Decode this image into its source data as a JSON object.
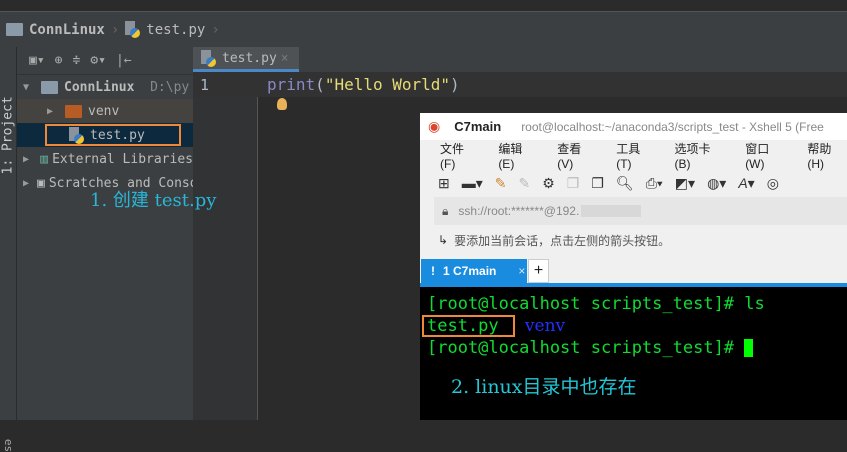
{
  "breadcrumb": {
    "project": "ConnLinux",
    "file": "test.py"
  },
  "toolwindow": {
    "label": "1: Project",
    "bottom_label": "es"
  },
  "project_tree": {
    "root": "ConnLinux",
    "root_path": "D:\\py",
    "items": [
      "venv",
      "test.py",
      "External Libraries",
      "Scratches and Consoles"
    ]
  },
  "editor": {
    "tab": "test.py",
    "line_number": "1",
    "code_fn": "print",
    "code_open": "(",
    "code_str": "\"Hello World\"",
    "code_close": ")"
  },
  "annotation1": "1. 创建 test.py",
  "xshell": {
    "session": "C7main",
    "title": "root@localhost:~/anaconda3/scripts_test - Xshell 5 (Free",
    "menu": [
      "文件(F)",
      "编辑(E)",
      "查看(V)",
      "工具(T)",
      "选项卡(B)",
      "窗口(W)",
      "帮助(H)"
    ],
    "address": "ssh://root:*******@192.",
    "hint": "要添加当前会话，点击左侧的箭头按钮。",
    "tab_alert": "!",
    "tab_label": "1 C7main",
    "tab_close": "×",
    "tab_add": "+",
    "terminal": {
      "line1": "[root@localhost scripts_test]# ls",
      "file1": "test.py",
      "file2": "venv",
      "line3": "[root@localhost scripts_test]# "
    },
    "annotation2": "2. linux目录中也存在"
  }
}
